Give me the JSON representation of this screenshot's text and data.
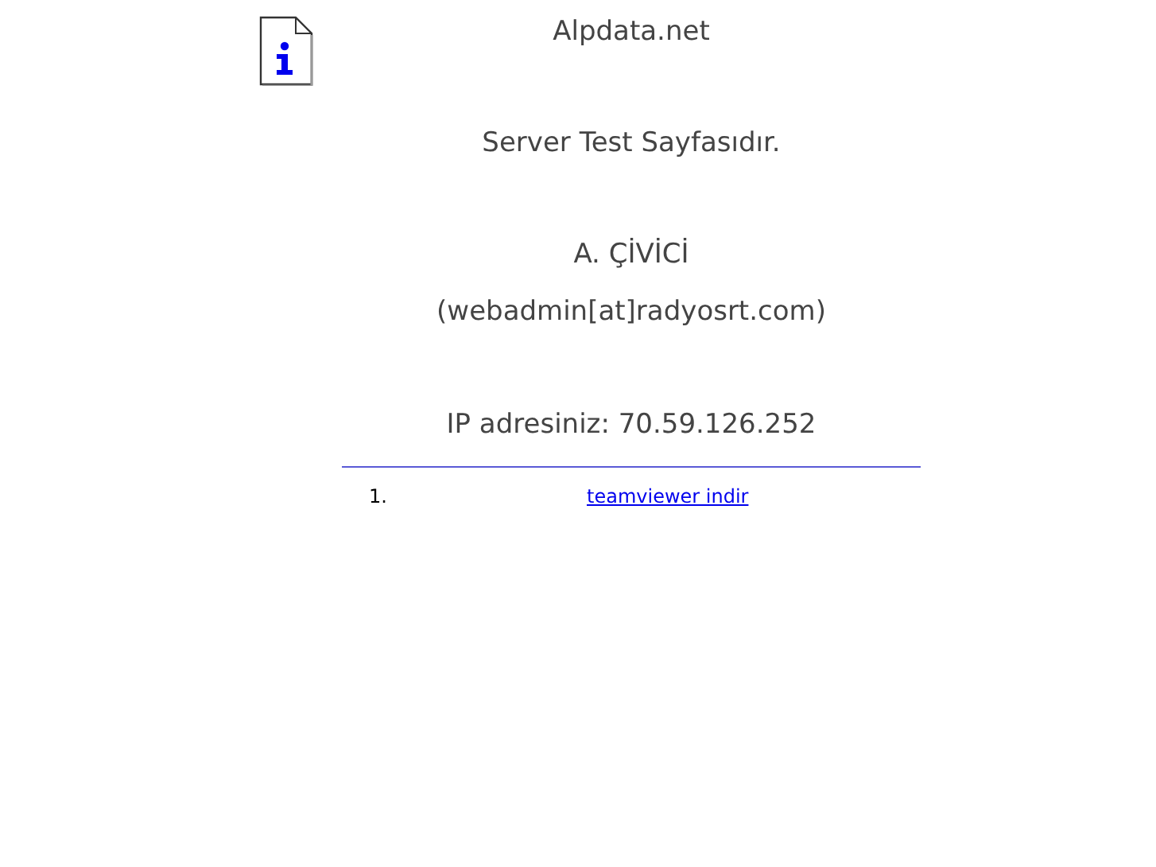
{
  "title": "Alpdata.net",
  "lines": [
    "Server Test Sayfasıdır.",
    "A. ÇİVİCİ",
    "(webadmin[at]radyosrt.com)",
    "IP adresiniz: 70.59.126.252"
  ],
  "links": [
    {
      "number": "1.",
      "label": "teamviewer indir"
    }
  ]
}
